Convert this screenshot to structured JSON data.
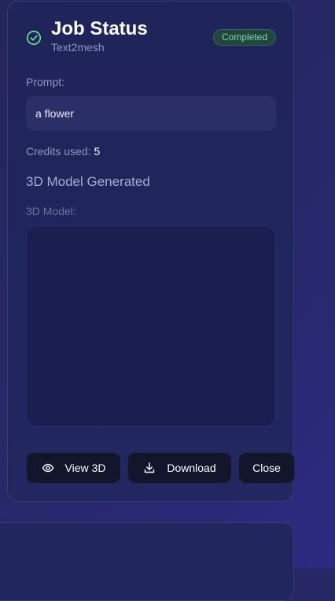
{
  "job": {
    "title": "Job Status",
    "type": "Text2mesh",
    "status": "Completed",
    "status_color": "#7dd9a1"
  },
  "prompt": {
    "label": "Prompt:",
    "value": "a flower"
  },
  "credits": {
    "label": "Credits used:",
    "value": "5"
  },
  "result": {
    "heading": "3D Model Generated",
    "model_label": "3D Model:"
  },
  "actions": {
    "view_label": "View 3D",
    "view_icon": "eye-icon",
    "download_label": "Download",
    "download_icon": "download-icon",
    "close_label": "Close"
  },
  "colors": {
    "background": "#27286a",
    "card": "#1f245a",
    "button": "#13152d"
  }
}
